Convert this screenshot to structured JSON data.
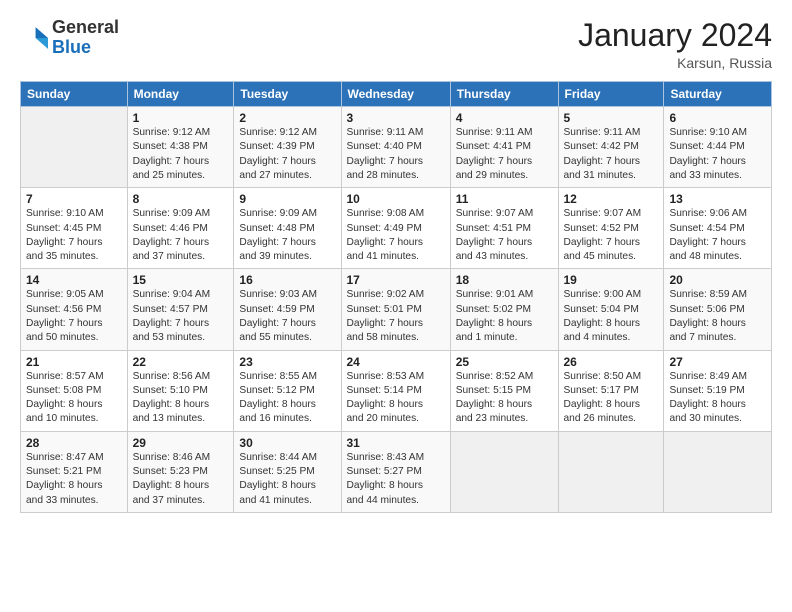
{
  "header": {
    "logo_general": "General",
    "logo_blue": "Blue",
    "month_title": "January 2024",
    "location": "Karsun, Russia"
  },
  "days_of_week": [
    "Sunday",
    "Monday",
    "Tuesday",
    "Wednesday",
    "Thursday",
    "Friday",
    "Saturday"
  ],
  "weeks": [
    [
      {
        "day": "",
        "info": ""
      },
      {
        "day": "1",
        "info": "Sunrise: 9:12 AM\nSunset: 4:38 PM\nDaylight: 7 hours\nand 25 minutes."
      },
      {
        "day": "2",
        "info": "Sunrise: 9:12 AM\nSunset: 4:39 PM\nDaylight: 7 hours\nand 27 minutes."
      },
      {
        "day": "3",
        "info": "Sunrise: 9:11 AM\nSunset: 4:40 PM\nDaylight: 7 hours\nand 28 minutes."
      },
      {
        "day": "4",
        "info": "Sunrise: 9:11 AM\nSunset: 4:41 PM\nDaylight: 7 hours\nand 29 minutes."
      },
      {
        "day": "5",
        "info": "Sunrise: 9:11 AM\nSunset: 4:42 PM\nDaylight: 7 hours\nand 31 minutes."
      },
      {
        "day": "6",
        "info": "Sunrise: 9:10 AM\nSunset: 4:44 PM\nDaylight: 7 hours\nand 33 minutes."
      }
    ],
    [
      {
        "day": "7",
        "info": "Sunrise: 9:10 AM\nSunset: 4:45 PM\nDaylight: 7 hours\nand 35 minutes."
      },
      {
        "day": "8",
        "info": "Sunrise: 9:09 AM\nSunset: 4:46 PM\nDaylight: 7 hours\nand 37 minutes."
      },
      {
        "day": "9",
        "info": "Sunrise: 9:09 AM\nSunset: 4:48 PM\nDaylight: 7 hours\nand 39 minutes."
      },
      {
        "day": "10",
        "info": "Sunrise: 9:08 AM\nSunset: 4:49 PM\nDaylight: 7 hours\nand 41 minutes."
      },
      {
        "day": "11",
        "info": "Sunrise: 9:07 AM\nSunset: 4:51 PM\nDaylight: 7 hours\nand 43 minutes."
      },
      {
        "day": "12",
        "info": "Sunrise: 9:07 AM\nSunset: 4:52 PM\nDaylight: 7 hours\nand 45 minutes."
      },
      {
        "day": "13",
        "info": "Sunrise: 9:06 AM\nSunset: 4:54 PM\nDaylight: 7 hours\nand 48 minutes."
      }
    ],
    [
      {
        "day": "14",
        "info": "Sunrise: 9:05 AM\nSunset: 4:56 PM\nDaylight: 7 hours\nand 50 minutes."
      },
      {
        "day": "15",
        "info": "Sunrise: 9:04 AM\nSunset: 4:57 PM\nDaylight: 7 hours\nand 53 minutes."
      },
      {
        "day": "16",
        "info": "Sunrise: 9:03 AM\nSunset: 4:59 PM\nDaylight: 7 hours\nand 55 minutes."
      },
      {
        "day": "17",
        "info": "Sunrise: 9:02 AM\nSunset: 5:01 PM\nDaylight: 7 hours\nand 58 minutes."
      },
      {
        "day": "18",
        "info": "Sunrise: 9:01 AM\nSunset: 5:02 PM\nDaylight: 8 hours\nand 1 minute."
      },
      {
        "day": "19",
        "info": "Sunrise: 9:00 AM\nSunset: 5:04 PM\nDaylight: 8 hours\nand 4 minutes."
      },
      {
        "day": "20",
        "info": "Sunrise: 8:59 AM\nSunset: 5:06 PM\nDaylight: 8 hours\nand 7 minutes."
      }
    ],
    [
      {
        "day": "21",
        "info": "Sunrise: 8:57 AM\nSunset: 5:08 PM\nDaylight: 8 hours\nand 10 minutes."
      },
      {
        "day": "22",
        "info": "Sunrise: 8:56 AM\nSunset: 5:10 PM\nDaylight: 8 hours\nand 13 minutes."
      },
      {
        "day": "23",
        "info": "Sunrise: 8:55 AM\nSunset: 5:12 PM\nDaylight: 8 hours\nand 16 minutes."
      },
      {
        "day": "24",
        "info": "Sunrise: 8:53 AM\nSunset: 5:14 PM\nDaylight: 8 hours\nand 20 minutes."
      },
      {
        "day": "25",
        "info": "Sunrise: 8:52 AM\nSunset: 5:15 PM\nDaylight: 8 hours\nand 23 minutes."
      },
      {
        "day": "26",
        "info": "Sunrise: 8:50 AM\nSunset: 5:17 PM\nDaylight: 8 hours\nand 26 minutes."
      },
      {
        "day": "27",
        "info": "Sunrise: 8:49 AM\nSunset: 5:19 PM\nDaylight: 8 hours\nand 30 minutes."
      }
    ],
    [
      {
        "day": "28",
        "info": "Sunrise: 8:47 AM\nSunset: 5:21 PM\nDaylight: 8 hours\nand 33 minutes."
      },
      {
        "day": "29",
        "info": "Sunrise: 8:46 AM\nSunset: 5:23 PM\nDaylight: 8 hours\nand 37 minutes."
      },
      {
        "day": "30",
        "info": "Sunrise: 8:44 AM\nSunset: 5:25 PM\nDaylight: 8 hours\nand 41 minutes."
      },
      {
        "day": "31",
        "info": "Sunrise: 8:43 AM\nSunset: 5:27 PM\nDaylight: 8 hours\nand 44 minutes."
      },
      {
        "day": "",
        "info": ""
      },
      {
        "day": "",
        "info": ""
      },
      {
        "day": "",
        "info": ""
      }
    ]
  ]
}
